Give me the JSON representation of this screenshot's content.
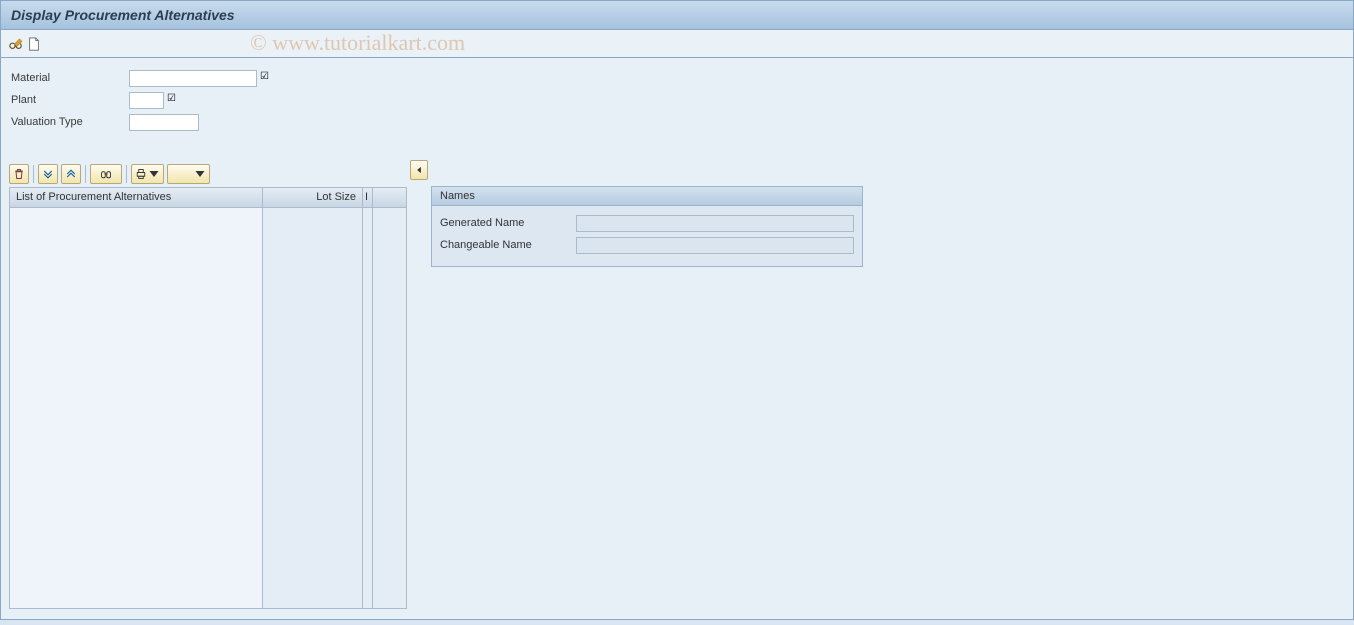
{
  "title": "Display Procurement Alternatives",
  "watermark": "© www.tutorialkart.com",
  "form": {
    "material_label": "Material",
    "material_value": "",
    "plant_label": "Plant",
    "plant_value": "",
    "valuation_label": "Valuation Type",
    "valuation_value": ""
  },
  "list": {
    "col1_header": "List of Procurement Alternatives",
    "col2_header": "Lot Size",
    "col3_header": "I"
  },
  "names_group": {
    "title": "Names",
    "generated_label": "Generated Name",
    "generated_value": "",
    "changeable_label": "Changeable Name",
    "changeable_value": ""
  }
}
